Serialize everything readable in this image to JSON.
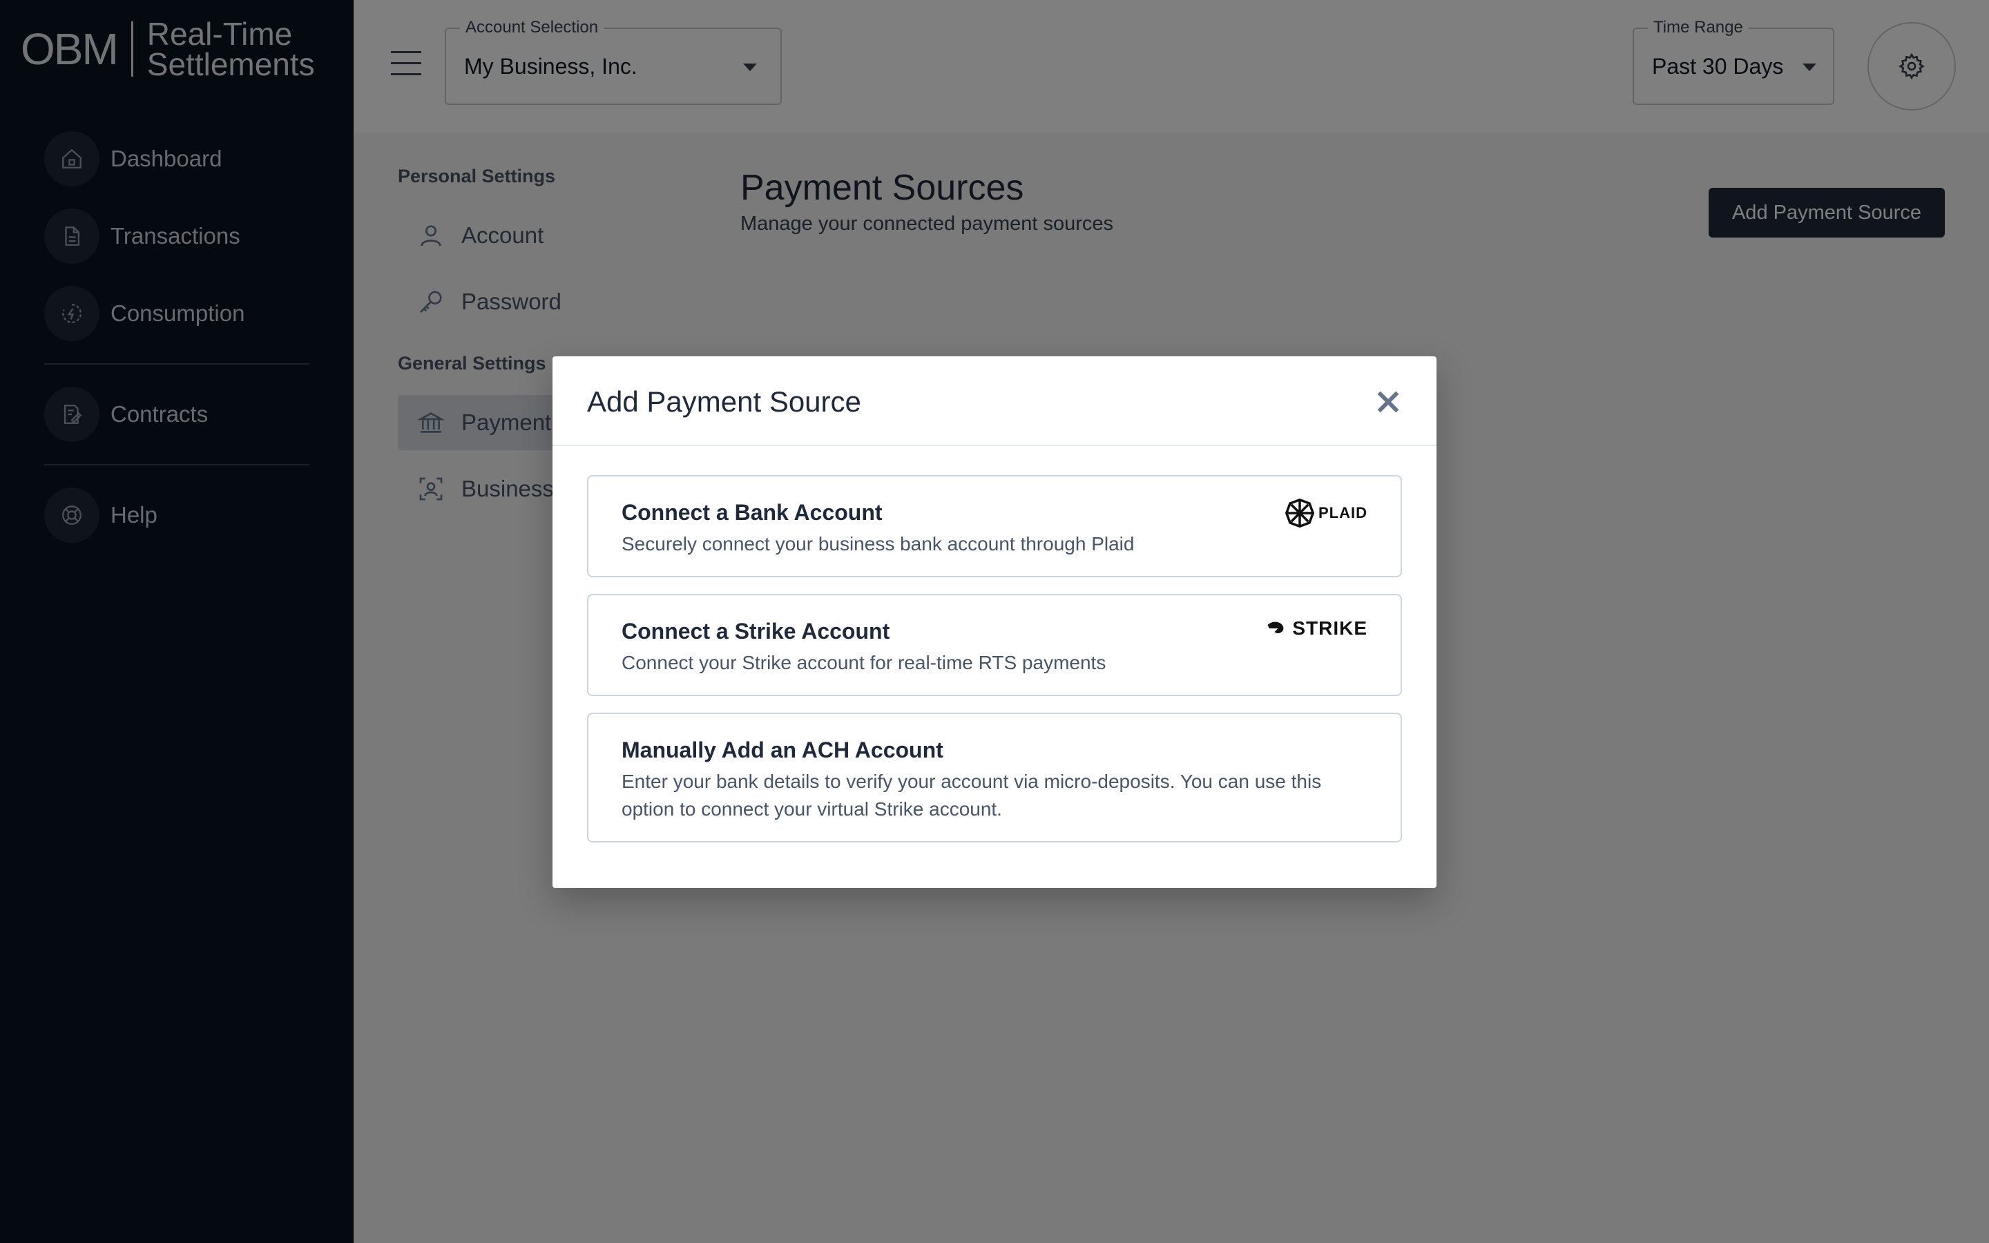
{
  "app": {
    "logo_mark": "OBM",
    "logo_line1": "Real-Time",
    "logo_line2": "Settlements"
  },
  "sidebar": {
    "items": [
      {
        "label": "Dashboard",
        "icon": "home-icon"
      },
      {
        "label": "Transactions",
        "icon": "document-icon"
      },
      {
        "label": "Consumption",
        "icon": "lightning-icon"
      },
      {
        "label": "Contracts",
        "icon": "contract-icon"
      },
      {
        "label": "Help",
        "icon": "lifebuoy-icon"
      }
    ]
  },
  "topbar": {
    "account_label": "Account Selection",
    "account_value": "My Business, Inc.",
    "time_label": "Time Range",
    "time_value": "Past 30 Days"
  },
  "settings_nav": {
    "personal_heading": "Personal Settings",
    "general_heading": "General Settings",
    "items": [
      {
        "label": "Account",
        "icon": "user-icon"
      },
      {
        "label": "Password",
        "icon": "key-icon"
      },
      {
        "label": "Payment",
        "icon": "bank-icon",
        "active": true
      },
      {
        "label": "Business",
        "icon": "business-icon"
      }
    ]
  },
  "content": {
    "title": "Payment Sources",
    "subtitle": "Manage your connected payment sources",
    "add_button": "Add Payment Source"
  },
  "modal": {
    "title": "Add Payment Source",
    "options": [
      {
        "title": "Connect a Bank Account",
        "description": "Securely connect your business bank account through Plaid",
        "brand": "PLAID"
      },
      {
        "title": "Connect a Strike Account",
        "description": "Connect your Strike account for real-time RTS payments",
        "brand": "STRIKE"
      },
      {
        "title": "Manually Add an ACH Account",
        "description": "Enter your bank details to verify your account via micro-deposits. You can use this option to connect your virtual Strike account."
      }
    ]
  }
}
